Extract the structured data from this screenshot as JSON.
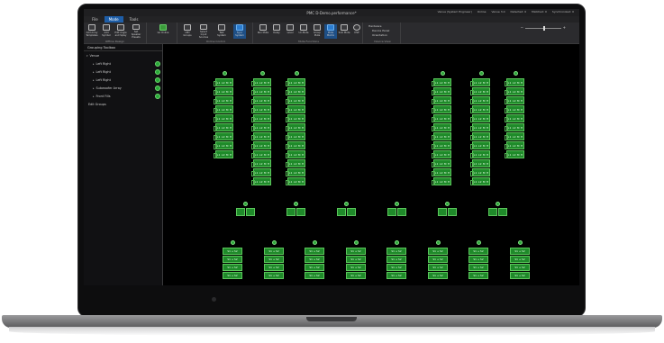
{
  "app": {
    "title": "PMC D-Demo.performance*",
    "status": [
      "Venue (System Engineer)",
      "Online",
      "Venue 3.0",
      "Detected: 0",
      "Matched: 0",
      "Synchronized: 0"
    ]
  },
  "tabs": [
    {
      "label": "File",
      "active": false
    },
    {
      "label": "Mode",
      "active": true
    },
    {
      "label": "Tools",
      "active": false
    }
  ],
  "ribbon": {
    "groups": [
      {
        "label": "Offline Design",
        "buttons": [
          "Add Array Templates",
          "Add Symbol",
          "Edit Angle and Splay",
          "Set Speaker Presets"
        ]
      },
      {
        "label": "",
        "buttons": [
          "Go Online"
        ]
      },
      {
        "label": "Online Control",
        "buttons": [
          "LED Groups",
          "Select Input Sources",
          "Test System",
          "Sync System"
        ]
      },
      {
        "label": "Mute Functions",
        "buttons": [
          "Run Mute",
          "Delay",
          "Level",
          "Un-Mute",
          "Group Mute",
          "Mute Matrix",
          "Solo Mute",
          "DSP"
        ]
      },
      {
        "label": "Device View",
        "items": [
          "Hardware",
          "Device Panel",
          "Orientation"
        ]
      }
    ],
    "colors": {
      "ribbon_bg": "#2b2b2e",
      "accent": "#1e5ea8",
      "green": "#1f8a2a"
    }
  },
  "sidebar": {
    "title": "Grouping Toolbox",
    "items": [
      {
        "label": "Venue",
        "level": 0,
        "badge": false
      },
      {
        "label": "Left Right",
        "level": 1,
        "badge": true
      },
      {
        "label": "Left Right",
        "level": 1,
        "badge": true
      },
      {
        "label": "Left Right",
        "level": 1,
        "badge": true
      },
      {
        "label": "Subwoofer Array",
        "level": 1,
        "badge": true
      },
      {
        "label": "Front Fills",
        "level": 1,
        "badge": true
      },
      {
        "label": "Edit Groups",
        "level": 0,
        "badge": false
      }
    ]
  },
  "canvas": {
    "array_label": "L1 L2 M H",
    "front_label": "S1 + S2",
    "arrays": [
      {
        "name": "array-1",
        "cabinets": 9
      },
      {
        "name": "array-2",
        "cabinets": 12
      },
      {
        "name": "array-3",
        "cabinets": 12
      },
      {
        "name": "array-4",
        "cabinets": 12
      },
      {
        "name": "array-5",
        "cabinets": 12
      },
      {
        "name": "array-6",
        "cabinets": 9
      }
    ],
    "subs_count": 6,
    "front_fills_count": 8
  }
}
